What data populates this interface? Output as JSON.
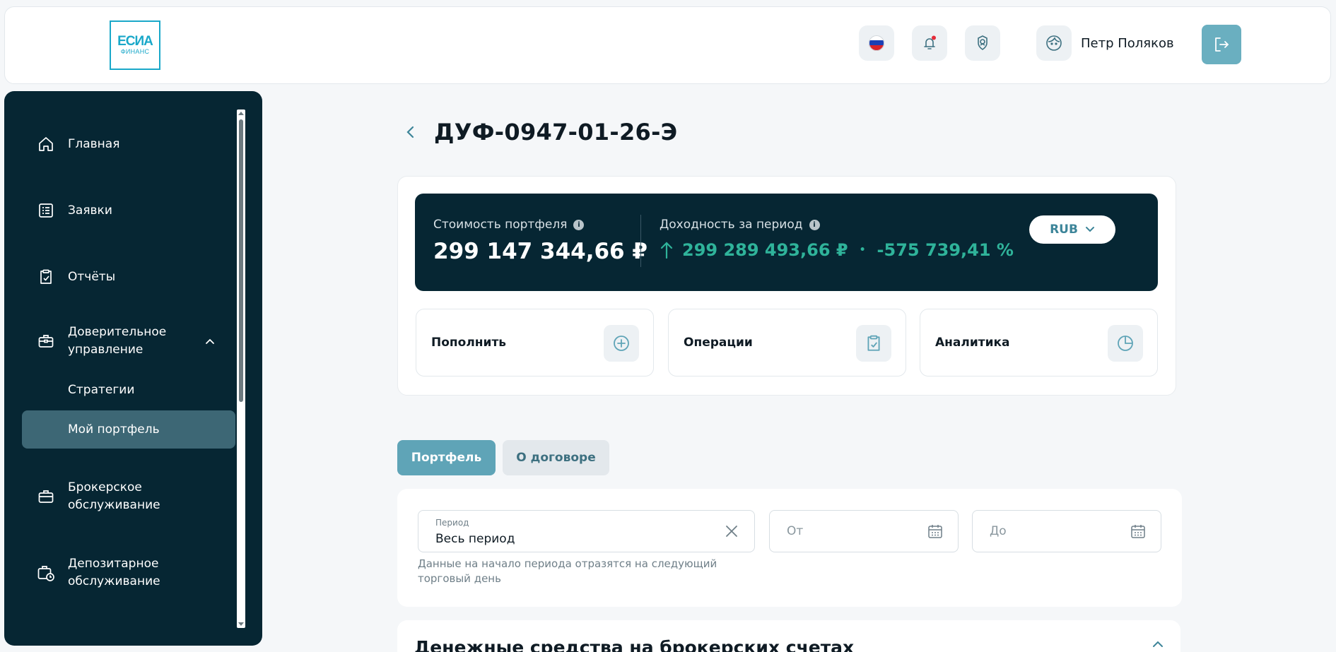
{
  "header": {
    "logo": {
      "line1": "ЕСИА",
      "line2": "ФИНАНС"
    },
    "buttons": [
      "flag-ru-icon",
      "bell-icon",
      "award-icon"
    ],
    "user_name": "Петр Поляков"
  },
  "sidebar": {
    "items": [
      {
        "label": "Главная",
        "icon": "home-icon"
      },
      {
        "label": "Заявки",
        "icon": "list-icon"
      },
      {
        "label": "Отчёты",
        "icon": "clipboard-check-icon"
      },
      {
        "label": "Доверительное управление",
        "icon": "briefcase-icon",
        "expanded": true,
        "children": [
          {
            "label": "Стратегии",
            "active": false
          },
          {
            "label": "Мой портфель",
            "active": true
          }
        ]
      },
      {
        "label": "Брокерское обслуживание",
        "icon": "case-icon"
      },
      {
        "label": "Депозитарное обслуживание",
        "icon": "case-clock-icon"
      }
    ]
  },
  "page": {
    "title": "ДУФ-0947-01-26-Э"
  },
  "summary": {
    "portfolio_label": "Стоимость портфеля",
    "portfolio_value": "299 147 344,66 ₽",
    "yield_label": "Доходность за период",
    "yield_amount": "299 289 493,66 ₽",
    "yield_separator": "•",
    "yield_percent": "-575 739,41 %",
    "currency": "RUB",
    "colors": {
      "dark": "#062633",
      "gain": "#2fb39a",
      "accent": "#5fa4b7"
    }
  },
  "actions": [
    {
      "label": "Пополнить",
      "icon": "plus-circle-icon"
    },
    {
      "label": "Операции",
      "icon": "clipboard-check-icon"
    },
    {
      "label": "Аналитика",
      "icon": "pie-chart-icon"
    }
  ],
  "tabs": [
    {
      "label": "Портфель",
      "active": true
    },
    {
      "label": "О договоре",
      "active": false
    }
  ],
  "filter": {
    "period_caption": "Период",
    "period_value": "Весь период",
    "from_placeholder": "От",
    "to_placeholder": "До",
    "hint": "Данные на начало периода отразятся на следующий торговый день"
  },
  "cash_section": {
    "title": "Денежные средства на брокерских счетах"
  }
}
